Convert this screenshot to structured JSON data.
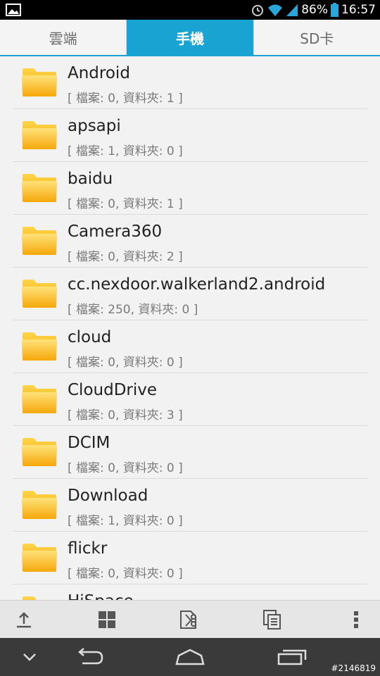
{
  "status_bar": {
    "battery_percent": "86%",
    "time": "16:57",
    "icons": [
      "image-icon",
      "alarm-icon",
      "wifi-icon",
      "signal-icon",
      "battery-icon"
    ]
  },
  "tabs": [
    {
      "label": "雲端",
      "active": false
    },
    {
      "label": "手機",
      "active": true
    },
    {
      "label": "SD卡",
      "active": false
    }
  ],
  "folders": [
    {
      "name": "Android",
      "meta": "[ 檔案: 0, 資料夾: 1 ]"
    },
    {
      "name": "apsapi",
      "meta": "[ 檔案: 1, 資料夾: 0 ]"
    },
    {
      "name": "baidu",
      "meta": "[ 檔案: 0, 資料夾: 1 ]"
    },
    {
      "name": "Camera360",
      "meta": "[ 檔案: 0, 資料夾: 2 ]"
    },
    {
      "name": "cc.nexdoor.walkerland2.android",
      "meta": "[ 檔案: 250, 資料夾: 0 ]"
    },
    {
      "name": "cloud",
      "meta": "[ 檔案: 0, 資料夾: 0 ]"
    },
    {
      "name": "CloudDrive",
      "meta": "[ 檔案: 0, 資料夾: 3 ]"
    },
    {
      "name": "DCIM",
      "meta": "[ 檔案: 0, 資料夾: 0 ]"
    },
    {
      "name": "Download",
      "meta": "[ 檔案: 1, 資料夾: 0 ]"
    },
    {
      "name": "flickr",
      "meta": "[ 檔案: 0, 資料夾: 0 ]"
    },
    {
      "name": "HiSpace",
      "meta": ""
    }
  ],
  "toolbar": [
    "upload-icon",
    "grid-icon",
    "cut-icon",
    "copy-icon",
    "overflow-menu-icon"
  ],
  "navbar": [
    "hide-keyboard-icon",
    "back-icon",
    "home-icon",
    "recents-icon"
  ],
  "watermark": "#2146819",
  "colors": {
    "accent": "#18a3d2",
    "folder": "#f9b21c"
  }
}
